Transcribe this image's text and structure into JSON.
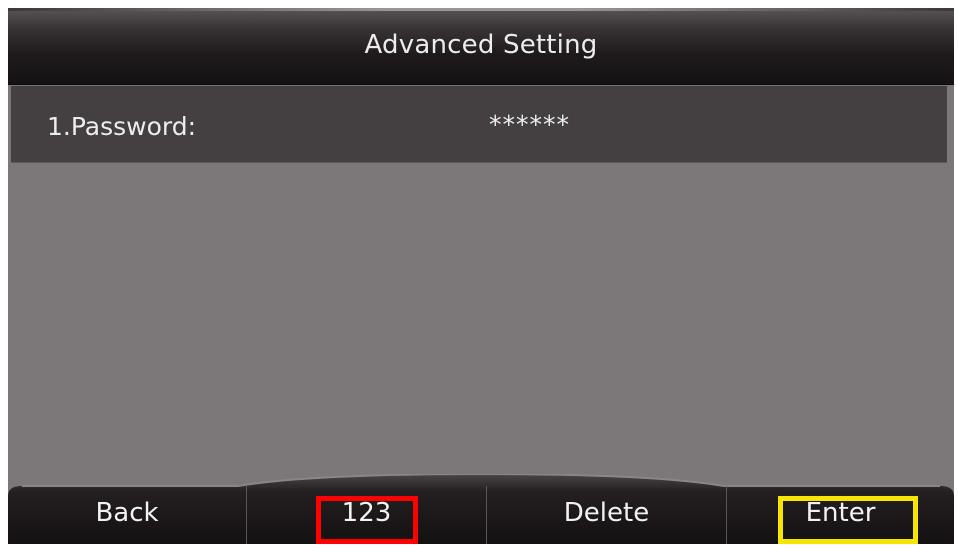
{
  "header": {
    "title": "Advanced Setting"
  },
  "menu": {
    "items": [
      {
        "label": "1.Password:",
        "value": "******"
      }
    ]
  },
  "softkeys": {
    "back": "Back",
    "input_mode": "123",
    "delete": "Delete",
    "enter": "Enter"
  },
  "colors": {
    "screen_background": "#7c7779",
    "selected_row": "#444041",
    "bar_dark": "#1a1617",
    "text": "#ededed",
    "highlight_red": "#ff0000",
    "highlight_yellow": "#f5e500"
  }
}
